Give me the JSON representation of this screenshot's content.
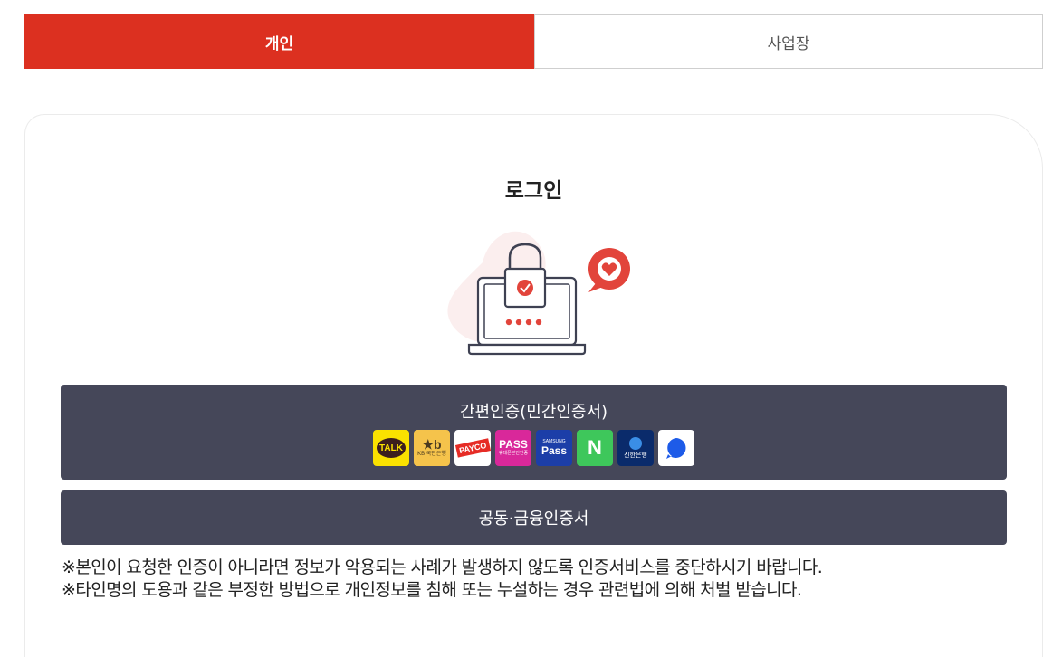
{
  "tabs": [
    {
      "label": "개인",
      "active": true
    },
    {
      "label": "사업장",
      "active": false
    }
  ],
  "login": {
    "title": "로그인"
  },
  "simple_auth": {
    "label": "간편인증(민간인증서)",
    "providers": [
      {
        "name": "kakao-talk",
        "text": "TALK",
        "color": "#fae100"
      },
      {
        "name": "kb-bank",
        "text": "KB 국민은행",
        "color": "#ffcc4d"
      },
      {
        "name": "payco",
        "text": "PAYCO",
        "color": "#ffffff"
      },
      {
        "name": "pass",
        "text": "PASS",
        "sub": "휴대폰본인인증",
        "color": "#d9289a"
      },
      {
        "name": "samsung-pass",
        "text": "Pass",
        "sub": "SAMSUNG",
        "color": "#1c3ea8"
      },
      {
        "name": "naver",
        "text": "N",
        "color": "#03c75a"
      },
      {
        "name": "shinhan-bank",
        "text": "신한은행",
        "color": "#0a2b6b"
      },
      {
        "name": "toss-chat",
        "text": "",
        "color": "#ffffff"
      }
    ]
  },
  "cert_button": {
    "label": "공동·금융인증서"
  },
  "notices": [
    "※본인이 요청한 인증이 아니라면 정보가 악용되는 사례가 발생하지 않도록 인증서비스를 중단하시기 바랍니다.",
    "※타인명의 도용과 같은 부정한 방법으로 개인정보를 침해 또는 누설하는 경우 관련법에 의해 처벌 받습니다."
  ],
  "colors": {
    "accent": "#dc3020",
    "button_bg": "#454759"
  }
}
